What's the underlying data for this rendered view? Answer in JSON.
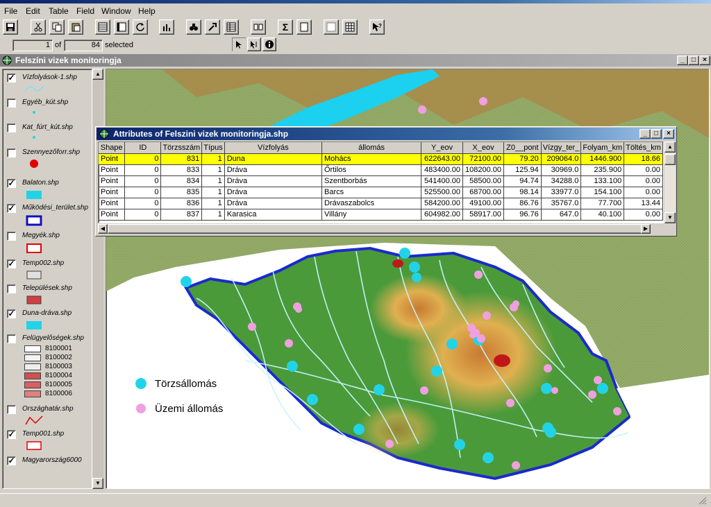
{
  "menu": [
    "File",
    "Edit",
    "Table",
    "Field",
    "Window",
    "Help"
  ],
  "toolbar": {
    "buttons": [
      "save-icon",
      "cut-icon",
      "copy-icon",
      "paste-icon",
      "select-all-icon",
      "select-none-icon",
      "refresh-icon",
      "chart-icon",
      "find-icon",
      "query-icon",
      "sort-icon",
      "join-icon",
      "sum-icon",
      "calc-icon",
      "promote-icon",
      "grid-icon",
      "help-icon"
    ]
  },
  "record": {
    "current": "1",
    "of_label": "of",
    "total": "84",
    "selected_label": "selected"
  },
  "view": {
    "title": "Felszíni vizek monitoringja"
  },
  "toc": {
    "layers": [
      {
        "name": "Vízfolyások-1.shp",
        "checked": true
      },
      {
        "name": "Egyéb_kút.shp",
        "checked": false
      },
      {
        "name": "Kat_fúrt_kút.shp",
        "checked": false
      },
      {
        "name": "Szennyezőforr.shp",
        "checked": false
      },
      {
        "name": "Balaton.shp",
        "checked": true
      },
      {
        "name": "Működési_terület.shp",
        "checked": true
      },
      {
        "name": "Megyék.shp",
        "checked": false
      },
      {
        "name": "Temp002.shp",
        "checked": true
      },
      {
        "name": "Települések.shp",
        "checked": false
      },
      {
        "name": "Duna-dráva.shp",
        "checked": true
      },
      {
        "name": "Felügyelőségek.shp",
        "checked": false
      },
      {
        "name": "Országhatár.shp",
        "checked": false
      },
      {
        "name": "Temp001.shp",
        "checked": true
      },
      {
        "name": "Magyarország6000",
        "checked": true
      }
    ],
    "classes": [
      "8100001",
      "8100002",
      "8100003",
      "8100004",
      "8100005",
      "8100006"
    ]
  },
  "map": {
    "legend": [
      {
        "label": "Törzsállomás",
        "color": "#22d3e8"
      },
      {
        "label": "Üzemi állomás",
        "color": "#f0a0e0"
      }
    ]
  },
  "attr": {
    "title": "Attributes of Felszini vizek monitoringja.shp",
    "columns": [
      "Shape",
      "ID",
      "Törzsszám",
      "Típus",
      "Vízfolyás",
      "állomás",
      "Y_eov",
      "X_eov",
      "Z0__pont",
      "Vízgy_ter_",
      "Folyam_km",
      "Töltés_km"
    ],
    "rows": [
      [
        "Point",
        "0",
        "831",
        "1",
        "Duna",
        "Mohács",
        "622643.00",
        "72100.00",
        "79.20",
        "209064.0",
        "1446.900",
        "18.66"
      ],
      [
        "Point",
        "0",
        "833",
        "1",
        "Dráva",
        "Őrtilos",
        "483400.00",
        "108200.00",
        "125.94",
        "30969.0",
        "235.900",
        "0.00"
      ],
      [
        "Point",
        "0",
        "834",
        "1",
        "Dráva",
        "Szentborbás",
        "541400.00",
        "58500.00",
        "94.74",
        "34288.0",
        "133.100",
        "0.00"
      ],
      [
        "Point",
        "0",
        "835",
        "1",
        "Dráva",
        "Barcs",
        "525500.00",
        "68700.00",
        "98.14",
        "33977.0",
        "154.100",
        "0.00"
      ],
      [
        "Point",
        "0",
        "836",
        "1",
        "Dráva",
        "Drávaszabolcs",
        "584200.00",
        "49100.00",
        "86.76",
        "35767.0",
        "77.700",
        "13.44"
      ],
      [
        "Point",
        "0",
        "837",
        "1",
        "Karasica",
        "Villány",
        "604982.00",
        "58917.00",
        "96.76",
        "647.0",
        "40.100",
        "0.00"
      ]
    ]
  }
}
